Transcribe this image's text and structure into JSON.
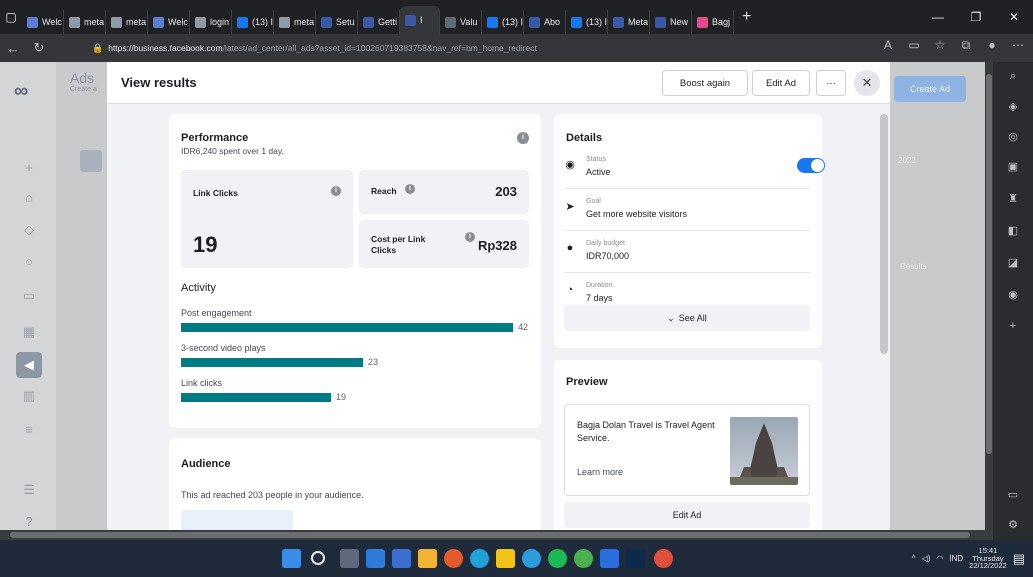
{
  "browser": {
    "tabs": [
      {
        "label": "Welc",
        "color": "#5b7fd6"
      },
      {
        "label": "meta",
        "color": "#8e9aa8"
      },
      {
        "label": "meta",
        "color": "#8e9aa8"
      },
      {
        "label": "Welc",
        "color": "#5b7fd6"
      },
      {
        "label": "login",
        "color": "#8e9aa8"
      },
      {
        "label": "(13) I",
        "color": "#1877f2"
      },
      {
        "label": "meta",
        "color": "#8e9aa8"
      },
      {
        "label": "Setu",
        "color": "#3a58a8"
      },
      {
        "label": "Getti",
        "color": "#3a58a8"
      },
      {
        "label": "I",
        "color": "#3a58a8"
      },
      {
        "label": "Valu",
        "color": "#5d6a78"
      },
      {
        "label": "(13) I",
        "color": "#1877f2"
      },
      {
        "label": "Abo",
        "color": "#3a58a8"
      },
      {
        "label": "(13) I",
        "color": "#1877f2"
      },
      {
        "label": "Meta",
        "color": "#3a58a8"
      },
      {
        "label": "New",
        "color": "#3a58a8"
      },
      {
        "label": "Bagj",
        "color": "#e64a8a"
      }
    ],
    "url_host": "https://business.facebook.com",
    "url_path": "/latest/ad_center/all_ads?asset_id=100260719383758&nav_ref=bm_home_redirect"
  },
  "app": {
    "title": "Ads",
    "subtitle": "Create a"
  },
  "modal": {
    "title": "View results",
    "boost_label": "Boost again",
    "edit_label": "Edit Ad",
    "more_label": "···",
    "close_label": "✕"
  },
  "performance": {
    "title": "Performance",
    "spent": "IDR6,240 spent over 1 day.",
    "link_clicks_label": "Link Clicks",
    "link_clicks_value": "19",
    "reach_label": "Reach",
    "reach_value": "203",
    "cpc_label": "Cost per Link Clicks",
    "cpc_value": "Rp328",
    "activity_title": "Activity",
    "activity": [
      {
        "label": "Post engagement",
        "value": 42
      },
      {
        "label": "3-second video plays",
        "value": 23
      },
      {
        "label": "Link clicks",
        "value": 19
      }
    ]
  },
  "audience": {
    "title": "Audience",
    "text": "This ad reached 203 people in your audience."
  },
  "details": {
    "title": "Details",
    "rows": [
      {
        "label": "Status",
        "value": "Active",
        "icon": "radio-icon"
      },
      {
        "label": "Goal",
        "value": "Get more website visitors",
        "icon": "cursor-icon"
      },
      {
        "label": "Daily budget",
        "value": "IDR70,000",
        "icon": "budget-icon"
      },
      {
        "label": "Duration",
        "value": "7 days",
        "icon": "stopwatch-icon"
      }
    ],
    "see_all": "See All"
  },
  "preview": {
    "title": "Preview",
    "text": "Bagja Dolan Travel is Travel Agent Service.",
    "link": "Learn more",
    "edit_label": "Edit Ad"
  },
  "bg_right": {
    "create_ad": "Create Ad",
    "date_hint": "2022",
    "results_hint": "Results"
  },
  "taskbar": {
    "lang": "IND",
    "time": "15:41",
    "day": "Thursday",
    "date": "22/12/2022"
  }
}
